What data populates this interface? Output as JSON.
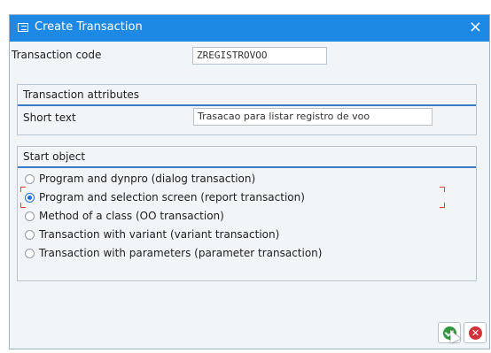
{
  "window": {
    "title": "Create Transaction",
    "close_glyph": "×"
  },
  "transaction_code": {
    "label": "Transaction code",
    "value": "ZREGISTROVOO"
  },
  "attributes": {
    "header": "Transaction attributes",
    "short_text_label": "Short text",
    "short_text_value": "Trasacao para listar registro de voo"
  },
  "start_object": {
    "header": "Start object",
    "options": [
      {
        "label": "Program and dynpro (dialog transaction)",
        "selected": false
      },
      {
        "label": "Program and selection screen (report transaction)",
        "selected": true
      },
      {
        "label": "Method of a class (OO transaction)",
        "selected": false
      },
      {
        "label": "Transaction with variant (variant transaction)",
        "selected": false
      },
      {
        "label": "Transaction with parameters (parameter transaction)",
        "selected": false
      }
    ]
  },
  "buttons": {
    "ok_icon": "check-icon",
    "cancel_icon": "cancel-icon",
    "cancel_glyph": "✕"
  },
  "colors": {
    "titlebar": "#1e88e5",
    "accent": "#3a7bc8",
    "ok": "#2e9a3e",
    "cancel": "#d3313a"
  }
}
